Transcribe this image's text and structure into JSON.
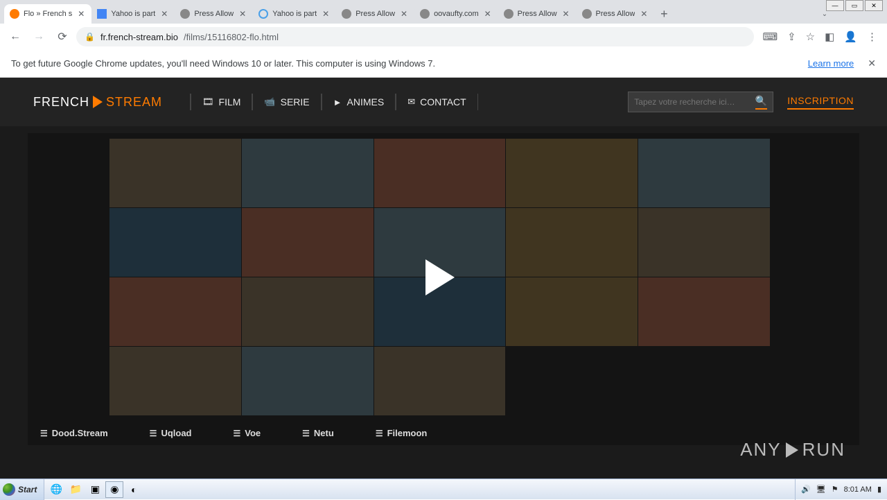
{
  "window": {
    "min": "—",
    "max": "▭",
    "close": "✕"
  },
  "tabs": [
    {
      "label": "Flo » French s",
      "favClass": "favi-orange",
      "active": true
    },
    {
      "label": "Yahoo is part",
      "favClass": "favi-blue"
    },
    {
      "label": "Press Allow",
      "favClass": "favi-globe"
    },
    {
      "label": "Yahoo is part",
      "favClass": "favi-ring"
    },
    {
      "label": "Press Allow",
      "favClass": "favi-globe"
    },
    {
      "label": "oovaufty.com",
      "favClass": "favi-globe"
    },
    {
      "label": "Press Allow",
      "favClass": "favi-globe"
    },
    {
      "label": "Press Allow",
      "favClass": "favi-globe"
    }
  ],
  "url": {
    "host": "fr.french-stream.bio",
    "path": "/films/15116802-flo.html"
  },
  "infobar": {
    "text": "To get future Google Chrome updates, you'll need Windows 10 or later. This computer is using Windows 7.",
    "learn": "Learn more"
  },
  "site": {
    "logo_a": "FRENCH",
    "logo_b": "STREAM",
    "nav": [
      {
        "icon": "🎞",
        "label": "FILM"
      },
      {
        "icon": "📹",
        "label": "SERIE"
      },
      {
        "icon": "►",
        "label": "ANIMES"
      },
      {
        "icon": "✉",
        "label": "CONTACT"
      }
    ],
    "search_placeholder": "Tapez votre recherche ici…",
    "inscription": "INSCRIPTION",
    "sources": [
      "Dood.Stream",
      "Uqload",
      "Voe",
      "Netu",
      "Filemoon"
    ],
    "watermark_a": "ANY",
    "watermark_b": "RUN"
  },
  "taskbar": {
    "start": "Start",
    "clock": "8:01 AM"
  }
}
